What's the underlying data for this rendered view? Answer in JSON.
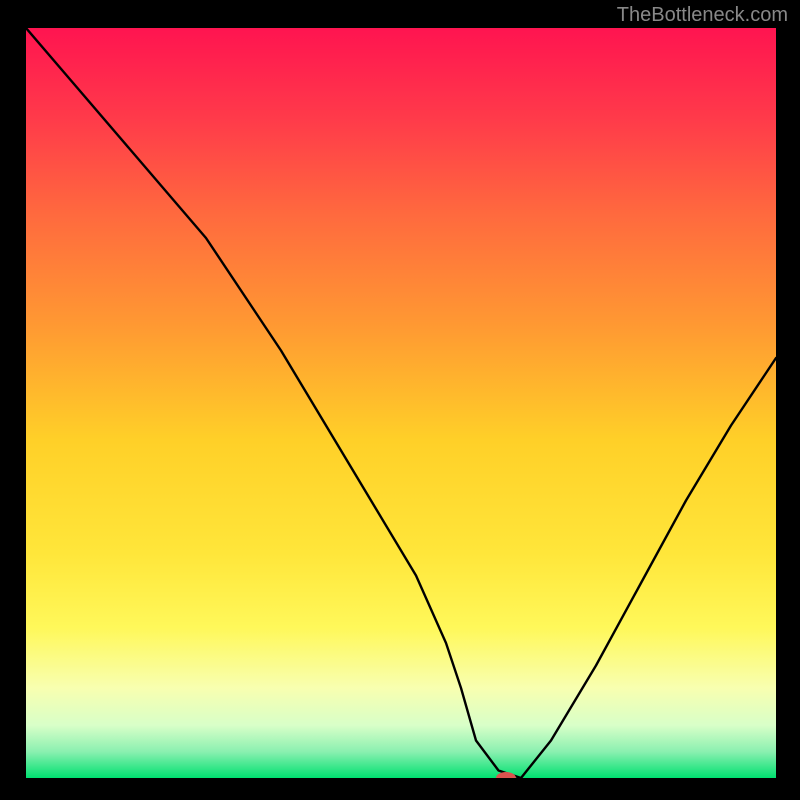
{
  "watermark": "TheBottleneck.com",
  "chart_data": {
    "type": "line",
    "title": "",
    "xlabel": "",
    "ylabel": "",
    "xlim": [
      0,
      100
    ],
    "ylim": [
      0,
      100
    ],
    "grid": false,
    "background_gradient": {
      "stops": [
        {
          "offset": 0.0,
          "color": "#ff1450"
        },
        {
          "offset": 0.12,
          "color": "#ff3a4a"
        },
        {
          "offset": 0.25,
          "color": "#ff6a3e"
        },
        {
          "offset": 0.4,
          "color": "#ff9a32"
        },
        {
          "offset": 0.55,
          "color": "#ffd028"
        },
        {
          "offset": 0.7,
          "color": "#ffe63a"
        },
        {
          "offset": 0.8,
          "color": "#fff85a"
        },
        {
          "offset": 0.88,
          "color": "#f8ffb0"
        },
        {
          "offset": 0.93,
          "color": "#d8ffc8"
        },
        {
          "offset": 0.965,
          "color": "#8af0b0"
        },
        {
          "offset": 1.0,
          "color": "#00e070"
        }
      ]
    },
    "series": [
      {
        "name": "bottleneck-curve",
        "color": "#000000",
        "width": 2.4,
        "x": [
          0,
          6,
          12,
          18,
          24,
          30,
          34,
          40,
          46,
          52,
          56,
          58,
          60,
          63,
          66,
          70,
          76,
          82,
          88,
          94,
          100
        ],
        "y": [
          100,
          93,
          86,
          79,
          72,
          63,
          57,
          47,
          37,
          27,
          18,
          12,
          5,
          1,
          0,
          5,
          15,
          26,
          37,
          47,
          56
        ]
      }
    ],
    "marker": {
      "name": "optimal-point",
      "x": 64,
      "y": 0,
      "rx": 10,
      "ry": 6,
      "color": "#d9534f"
    }
  }
}
